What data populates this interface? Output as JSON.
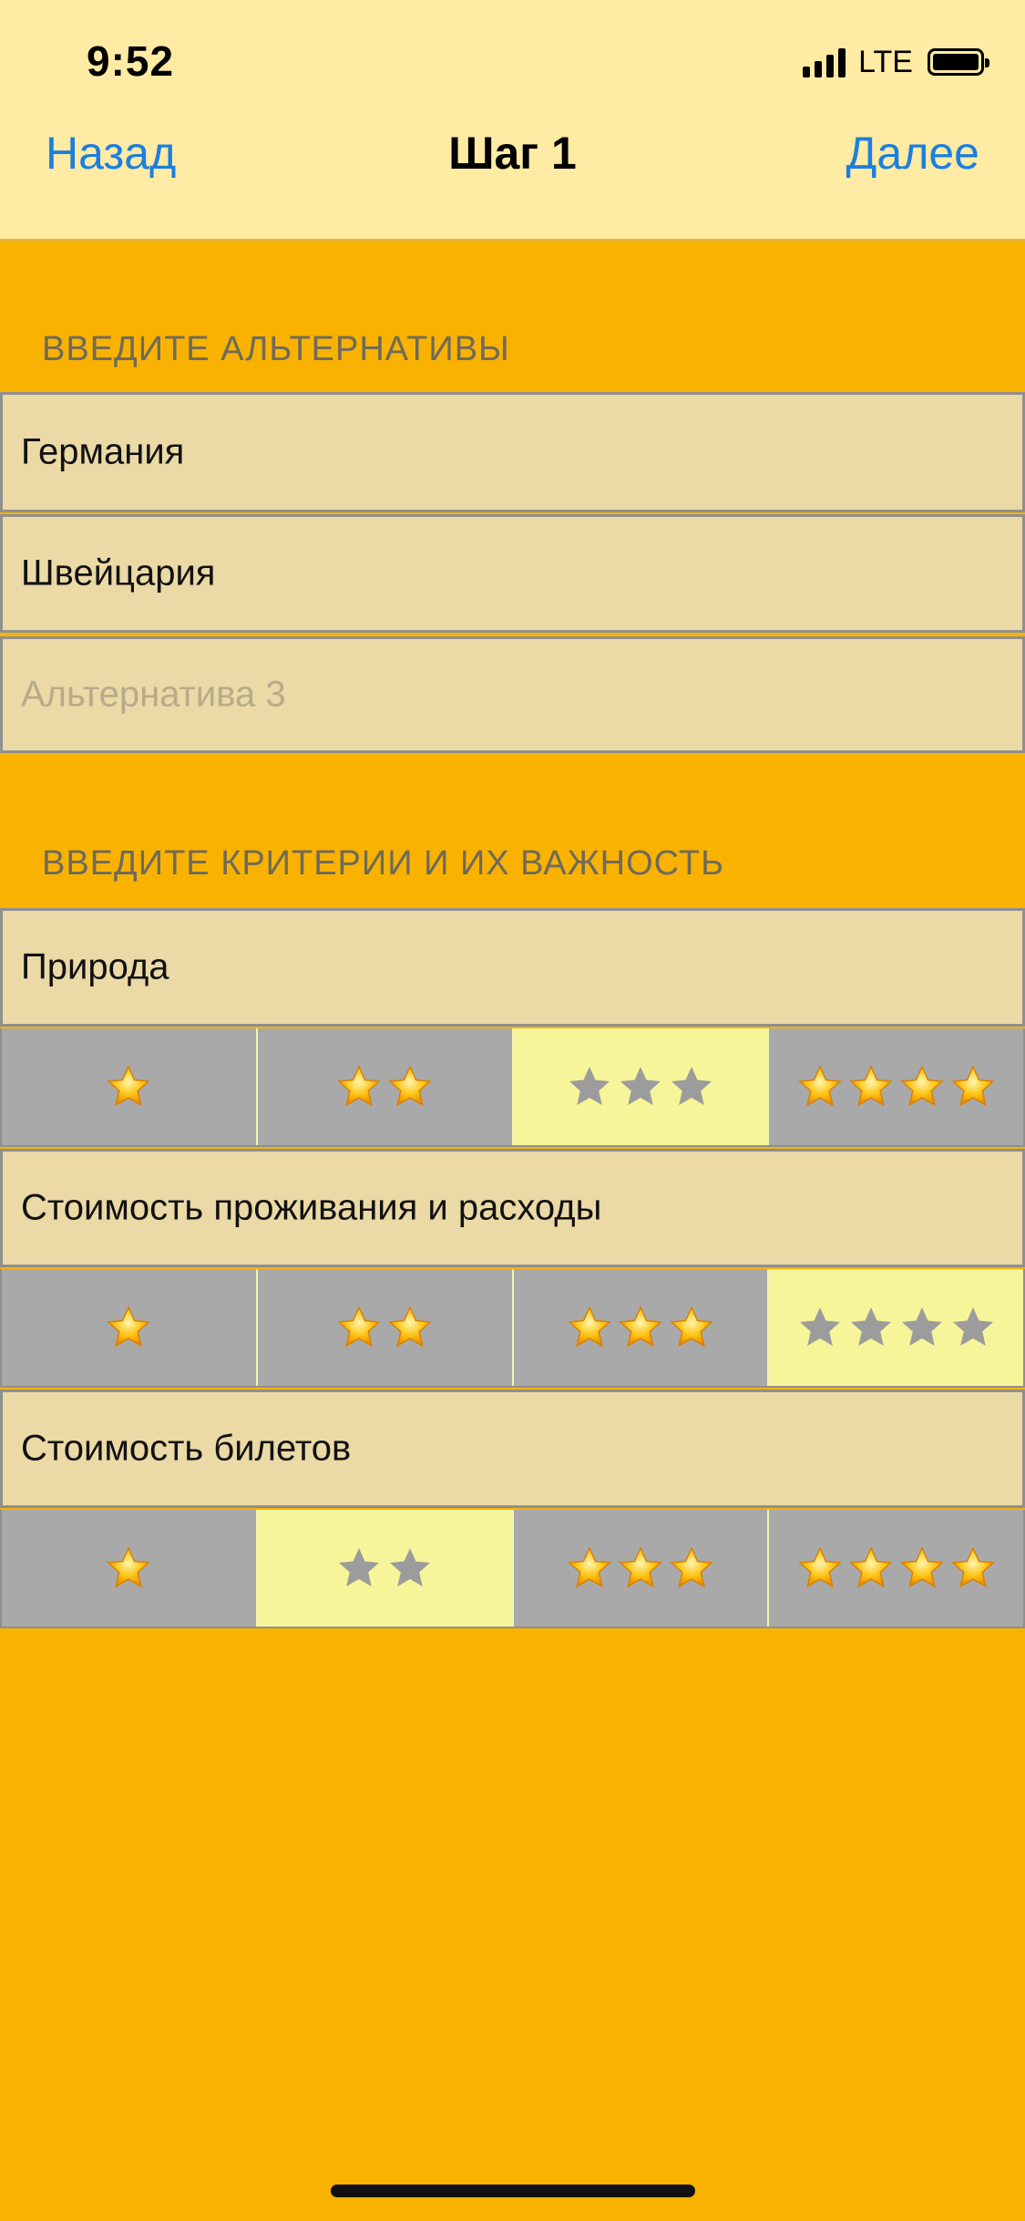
{
  "status_bar": {
    "time": "9:52",
    "network": "LTE"
  },
  "nav": {
    "back_label": "Назад",
    "title": "Шаг 1",
    "next_label": "Далее"
  },
  "alternatives": {
    "header": "ВВЕДИТЕ АЛЬТЕРНАТИВЫ",
    "items": [
      {
        "value": "Германия"
      },
      {
        "value": "Швейцария"
      },
      {
        "value": "",
        "placeholder": "Альтернатива 3"
      }
    ]
  },
  "criteria": {
    "header": "ВВЕДИТЕ КРИТЕРИИ И ИХ ВАЖНОСТЬ",
    "rating_options": [
      1,
      2,
      3,
      4
    ],
    "items": [
      {
        "name": "Природа",
        "importance": 3
      },
      {
        "name": "Стоимость проживания и расходы",
        "importance": 4
      },
      {
        "name": "Стоимость билетов",
        "importance": 2
      }
    ]
  },
  "colors": {
    "background": "#F9B200",
    "nav_bar": "#FFEBA3",
    "accent_link": "#1A7FE0",
    "cell_bg": "#EBD9A6",
    "segment_bg": "#A9A9A9",
    "segment_selected": "#F7F59A",
    "star_gold": "#FFC414",
    "star_grey": "#9C9C9C"
  },
  "icons": {
    "rating": "star-icon",
    "signal": "cellular-signal-icon",
    "battery": "battery-icon"
  }
}
